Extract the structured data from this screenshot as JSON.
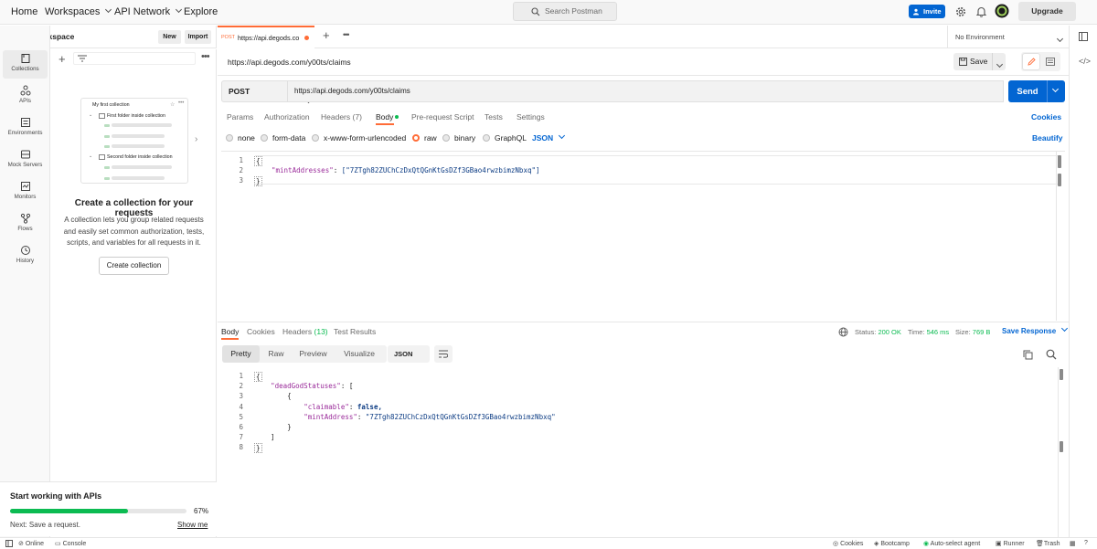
{
  "topbar": {
    "home": "Home",
    "workspaces": "Workspaces",
    "api_network": "API Network",
    "explore": "Explore",
    "search_placeholder": "Search Postman",
    "invite": "Invite",
    "upgrade": "Upgrade"
  },
  "sidebar": {
    "workspace_name": "My Workspace",
    "new_label": "New",
    "import_label": "Import",
    "items": [
      {
        "label": "Collections",
        "icon": "collections-icon"
      },
      {
        "label": "APIs",
        "icon": "apis-icon"
      },
      {
        "label": "Environments",
        "icon": "environments-icon"
      },
      {
        "label": "Mock Servers",
        "icon": "mock-servers-icon"
      },
      {
        "label": "Monitors",
        "icon": "monitors-icon"
      },
      {
        "label": "Flows",
        "icon": "flows-icon"
      },
      {
        "label": "History",
        "icon": "history-icon"
      }
    ],
    "illustration": {
      "title": "My first collection",
      "folder1": "First folder inside collection",
      "folder2": "Second folder inside collection"
    },
    "empty_title": "Create a collection for your requests",
    "empty_desc": "A collection lets you group related requests and easily set common authorization, tests, scripts, and variables for all requests in it.",
    "create_button": "Create collection",
    "start_title": "Start working with APIs",
    "progress_percent": 67,
    "progress_label": "67%",
    "next_step": "Next: Save a request.",
    "show_me": "Show me"
  },
  "tabs": {
    "active": {
      "method": "POST",
      "title": "https://api.degods.co"
    },
    "environment": "No Environment"
  },
  "request": {
    "name": "https://api.degods.com/y00ts/claims",
    "save_label": "Save",
    "method": "POST",
    "url": "https://api.degods.com/y00ts/claims",
    "send_label": "Send",
    "tabs": [
      {
        "label": "Params"
      },
      {
        "label": "Authorization"
      },
      {
        "label": "Headers",
        "count": "(7)"
      },
      {
        "label": "Body"
      },
      {
        "label": "Pre-request Script"
      },
      {
        "label": "Tests"
      },
      {
        "label": "Settings"
      }
    ],
    "cookies_label": "Cookies",
    "body_options": [
      "none",
      "form-data",
      "x-www-form-urlencoded",
      "raw",
      "binary",
      "GraphQL"
    ],
    "body_format": "JSON",
    "beautify": "Beautify",
    "body_lines": [
      {
        "n": "1",
        "text": "{"
      },
      {
        "n": "2",
        "key": "\"mintAddresses\"",
        "value": "[\"7ZTgh82ZUChCzDxQtQGnKtGsDZf3GBao4rwzbimzNbxq\"]"
      },
      {
        "n": "3",
        "text": "}"
      }
    ]
  },
  "response": {
    "tabs": [
      {
        "label": "Body"
      },
      {
        "label": "Cookies"
      },
      {
        "label": "Headers",
        "count": "(13)"
      },
      {
        "label": "Test Results"
      }
    ],
    "status_label": "Status:",
    "status_value": "200 OK",
    "time_label": "Time:",
    "time_value": "546 ms",
    "size_label": "Size:",
    "size_value": "769 B",
    "save_response": "Save Response",
    "views": [
      "Pretty",
      "Raw",
      "Preview",
      "Visualize"
    ],
    "format": "JSON",
    "lines": [
      {
        "n": "1",
        "text": "{"
      },
      {
        "n": "2",
        "text": "    \"deadGodStatuses\": ["
      },
      {
        "n": "3",
        "text": "        {"
      },
      {
        "n": "4",
        "text": "            \"claimable\": false,"
      },
      {
        "n": "5",
        "text": "            \"mintAddress\": \"7ZTgh82ZUChCzDxQtQGnKtGsDZf3GBao4rwzbimzNbxq\""
      },
      {
        "n": "6",
        "text": "        }"
      },
      {
        "n": "7",
        "text": "    ]"
      },
      {
        "n": "8",
        "text": "}"
      }
    ]
  },
  "statusbar": {
    "online": "Online",
    "console": "Console",
    "cookies": "Cookies",
    "bootcamp": "Bootcamp",
    "auto_select": "Auto-select agent",
    "runner": "Runner",
    "trash": "Trash"
  },
  "colors": {
    "accent": "#ff6c37",
    "primary": "#0265d2",
    "success": "#0cbb52"
  }
}
